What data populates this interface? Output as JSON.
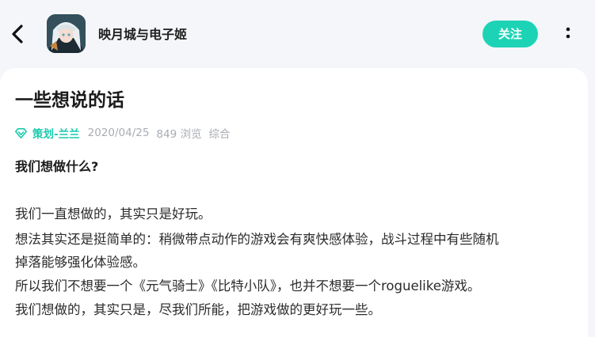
{
  "header": {
    "app_name": "映月城与电子姬",
    "follow_label": "关注"
  },
  "post": {
    "title": "一些想说的话",
    "author": "策划-兰兰",
    "date": "2020/04/25",
    "views": "849 浏览",
    "category": "综合",
    "subheading": "我们想做什么?",
    "lines": [
      "我们一直想做的，其实只是好玩。",
      "想法其实还是挺简单的：稍微带点动作的游戏会有爽快感体验，战斗过程中有些随机",
      "掉落能够强化体验感。",
      "所以我们不想要一个《元气骑士》《比特小队》，也并不想要一个roguelike游戏。",
      "我们想做的，其实只是，尽我们所能，把游戏做的更好玩一些。"
    ]
  },
  "colors": {
    "accent": "#1dd3b5",
    "background": "#f4f6f9",
    "card": "#ffffff"
  }
}
